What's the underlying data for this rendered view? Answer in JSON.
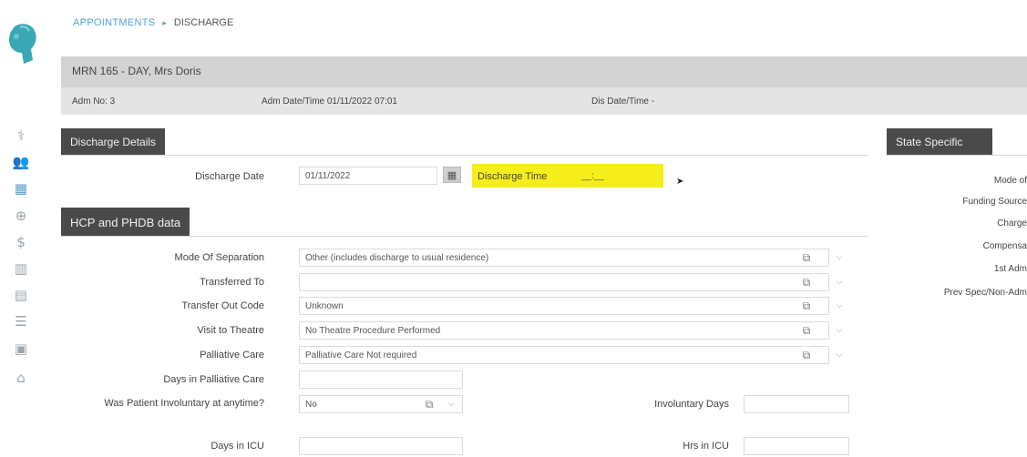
{
  "breadcrumb": {
    "parent": "APPOINTMENTS",
    "separator": "▸",
    "current": "DISCHARGE"
  },
  "patient": {
    "name": "MRN 165 - DAY, Mrs Doris",
    "adm_no": "Adm No: 3",
    "adm_datetime": "Adm Date/Time 01/11/2022 07:01",
    "dis_datetime": "Dis Date/Time -"
  },
  "sections": {
    "discharge_details": "Discharge Details",
    "hcp_phdb": "HCP and PHDB data",
    "state_specific": "State Specific"
  },
  "discharge": {
    "date_label": "Discharge Date",
    "date_value": "01/11/2022",
    "time_label": "Discharge Time",
    "time_value": "__:__"
  },
  "hcp_fields": [
    {
      "label": "Mode Of Separation",
      "value": "Other (includes discharge to usual residence)"
    },
    {
      "label": "Transferred To",
      "value": ""
    },
    {
      "label": "Transfer Out Code",
      "value": "Unknown"
    },
    {
      "label": "Visit to Theatre",
      "value": "No Theatre Procedure Performed"
    },
    {
      "label": "Palliative Care",
      "value": "Palliative Care Not required"
    }
  ],
  "days_palliative": {
    "label": "Days in Palliative Care",
    "value": ""
  },
  "involuntary": {
    "label": "Was Patient Involuntary at anytime?",
    "value": "No",
    "days_label": "Involuntary Days",
    "days_value": ""
  },
  "icu": {
    "days_label": "Days in ICU",
    "days_value": "",
    "hours_label": "Hrs in ICU",
    "hours_value": ""
  },
  "state_labels": [
    "Mode of",
    "Funding Source",
    "Charge",
    "Compensa",
    "1st Adm",
    "Prev Spec/Non-Adm"
  ],
  "sidebar_icons": [
    "medical-icon",
    "people-icon",
    "calendar-icon",
    "globe-icon",
    "dollar-icon",
    "chart-icon",
    "document-icon",
    "list-icon",
    "summary-icon",
    "building-icon"
  ],
  "colors": {
    "accent": "#4aa3d8",
    "header_dark": "#4a4a4a",
    "highlight": "#f5ee1a"
  }
}
